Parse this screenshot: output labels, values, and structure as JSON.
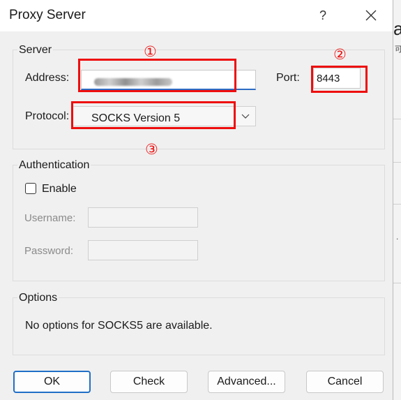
{
  "dialog": {
    "title": "Proxy Server",
    "help_label": "?",
    "close_label": "✕"
  },
  "server": {
    "group_title": "Server",
    "address_label": "Address:",
    "port_label": "Port:",
    "port_value": "8443",
    "protocol_label": "Protocol:",
    "protocol_value": "SOCKS Version 5"
  },
  "authentication": {
    "group_title": "Authentication",
    "enable_label": "Enable",
    "enable_checked": false,
    "username_label": "Username:",
    "password_label": "Password:"
  },
  "options": {
    "group_title": "Options",
    "message": "No options for SOCKS5 are available."
  },
  "buttons": {
    "ok": "OK",
    "check": "Check",
    "advanced": "Advanced...",
    "cancel": "Cancel"
  },
  "annotations": {
    "mark_1": "①",
    "mark_2": "②",
    "mark_3": "③",
    "color": "#ee0d0d"
  },
  "background_app": {
    "fragment_large": "a",
    "fragment_small": "可",
    "fragment_dots": "."
  },
  "colors": {
    "accent": "#1f6fc6",
    "dialog_bg": "#f0f0f0"
  }
}
